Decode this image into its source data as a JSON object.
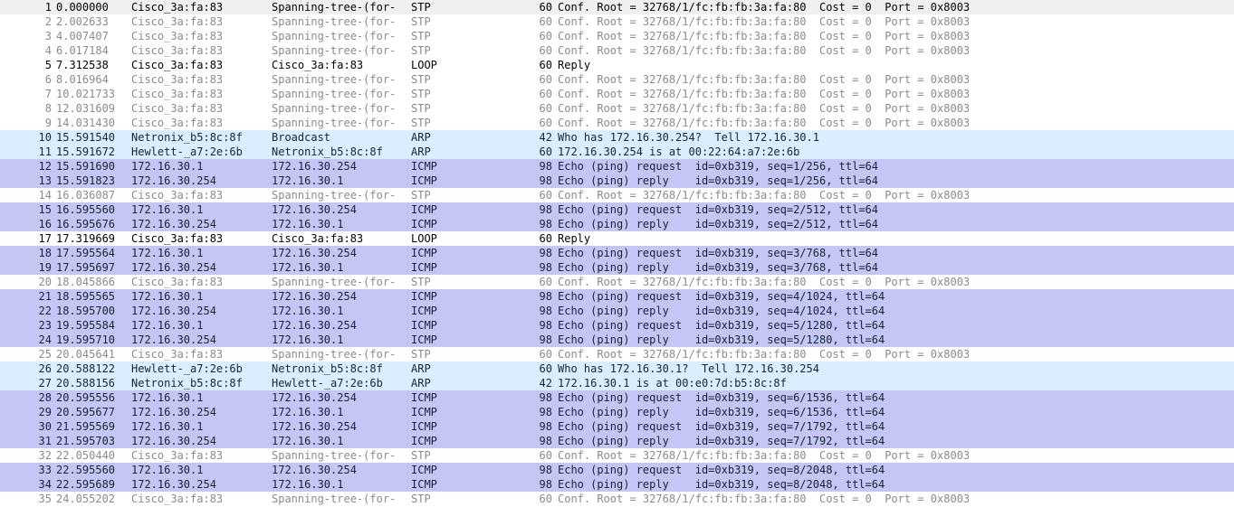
{
  "colors": {
    "stp_bg": "#ffffff",
    "stp_fg": "#8b8b8b",
    "loop_bg": "#ffffff",
    "loop_fg": "#000000",
    "arp_bg": "#daeeff",
    "icmp_bg": "#c6c6f6",
    "selected_bg": "#f0f0f0"
  },
  "packets": [
    {
      "no": "1",
      "time": "0.000000",
      "src": "Cisco_3a:fa:83",
      "dst": "Spanning-tree-(for-",
      "proto": "STP",
      "len": "60",
      "info": "Conf. Root = 32768/1/fc:fb:fb:3a:fa:80  Cost = 0  Port = 0x8003",
      "kind": "stp",
      "selected": true
    },
    {
      "no": "2",
      "time": "2.002633",
      "src": "Cisco_3a:fa:83",
      "dst": "Spanning-tree-(for-",
      "proto": "STP",
      "len": "60",
      "info": "Conf. Root = 32768/1/fc:fb:fb:3a:fa:80  Cost = 0  Port = 0x8003",
      "kind": "stp"
    },
    {
      "no": "3",
      "time": "4.007407",
      "src": "Cisco_3a:fa:83",
      "dst": "Spanning-tree-(for-",
      "proto": "STP",
      "len": "60",
      "info": "Conf. Root = 32768/1/fc:fb:fb:3a:fa:80  Cost = 0  Port = 0x8003",
      "kind": "stp"
    },
    {
      "no": "4",
      "time": "6.017184",
      "src": "Cisco_3a:fa:83",
      "dst": "Spanning-tree-(for-",
      "proto": "STP",
      "len": "60",
      "info": "Conf. Root = 32768/1/fc:fb:fb:3a:fa:80  Cost = 0  Port = 0x8003",
      "kind": "stp"
    },
    {
      "no": "5",
      "time": "7.312538",
      "src": "Cisco_3a:fa:83",
      "dst": "Cisco_3a:fa:83",
      "proto": "LOOP",
      "len": "60",
      "info": "Reply",
      "kind": "loop"
    },
    {
      "no": "6",
      "time": "8.016964",
      "src": "Cisco_3a:fa:83",
      "dst": "Spanning-tree-(for-",
      "proto": "STP",
      "len": "60",
      "info": "Conf. Root = 32768/1/fc:fb:fb:3a:fa:80  Cost = 0  Port = 0x8003",
      "kind": "stp"
    },
    {
      "no": "7",
      "time": "10.021733",
      "src": "Cisco_3a:fa:83",
      "dst": "Spanning-tree-(for-",
      "proto": "STP",
      "len": "60",
      "info": "Conf. Root = 32768/1/fc:fb:fb:3a:fa:80  Cost = 0  Port = 0x8003",
      "kind": "stp"
    },
    {
      "no": "8",
      "time": "12.031609",
      "src": "Cisco_3a:fa:83",
      "dst": "Spanning-tree-(for-",
      "proto": "STP",
      "len": "60",
      "info": "Conf. Root = 32768/1/fc:fb:fb:3a:fa:80  Cost = 0  Port = 0x8003",
      "kind": "stp"
    },
    {
      "no": "9",
      "time": "14.031430",
      "src": "Cisco_3a:fa:83",
      "dst": "Spanning-tree-(for-",
      "proto": "STP",
      "len": "60",
      "info": "Conf. Root = 32768/1/fc:fb:fb:3a:fa:80  Cost = 0  Port = 0x8003",
      "kind": "stp"
    },
    {
      "no": "10",
      "time": "15.591540",
      "src": "Netronix_b5:8c:8f",
      "dst": "Broadcast",
      "proto": "ARP",
      "len": "42",
      "info": "Who has 172.16.30.254?  Tell 172.16.30.1",
      "kind": "arp"
    },
    {
      "no": "11",
      "time": "15.591672",
      "src": "Hewlett-_a7:2e:6b",
      "dst": "Netronix_b5:8c:8f",
      "proto": "ARP",
      "len": "60",
      "info": "172.16.30.254 is at 00:22:64:a7:2e:6b",
      "kind": "arp"
    },
    {
      "no": "12",
      "time": "15.591690",
      "src": "172.16.30.1",
      "dst": "172.16.30.254",
      "proto": "ICMP",
      "len": "98",
      "info": "Echo (ping) request  id=0xb319, seq=1/256, ttl=64",
      "kind": "icmp"
    },
    {
      "no": "13",
      "time": "15.591823",
      "src": "172.16.30.254",
      "dst": "172.16.30.1",
      "proto": "ICMP",
      "len": "98",
      "info": "Echo (ping) reply    id=0xb319, seq=1/256, ttl=64",
      "kind": "icmp"
    },
    {
      "no": "14",
      "time": "16.036087",
      "src": "Cisco_3a:fa:83",
      "dst": "Spanning-tree-(for-",
      "proto": "STP",
      "len": "60",
      "info": "Conf. Root = 32768/1/fc:fb:fb:3a:fa:80  Cost = 0  Port = 0x8003",
      "kind": "stp"
    },
    {
      "no": "15",
      "time": "16.595560",
      "src": "172.16.30.1",
      "dst": "172.16.30.254",
      "proto": "ICMP",
      "len": "98",
      "info": "Echo (ping) request  id=0xb319, seq=2/512, ttl=64",
      "kind": "icmp"
    },
    {
      "no": "16",
      "time": "16.595676",
      "src": "172.16.30.254",
      "dst": "172.16.30.1",
      "proto": "ICMP",
      "len": "98",
      "info": "Echo (ping) reply    id=0xb319, seq=2/512, ttl=64",
      "kind": "icmp"
    },
    {
      "no": "17",
      "time": "17.319669",
      "src": "Cisco_3a:fa:83",
      "dst": "Cisco_3a:fa:83",
      "proto": "LOOP",
      "len": "60",
      "info": "Reply",
      "kind": "loop"
    },
    {
      "no": "18",
      "time": "17.595564",
      "src": "172.16.30.1",
      "dst": "172.16.30.254",
      "proto": "ICMP",
      "len": "98",
      "info": "Echo (ping) request  id=0xb319, seq=3/768, ttl=64",
      "kind": "icmp"
    },
    {
      "no": "19",
      "time": "17.595697",
      "src": "172.16.30.254",
      "dst": "172.16.30.1",
      "proto": "ICMP",
      "len": "98",
      "info": "Echo (ping) reply    id=0xb319, seq=3/768, ttl=64",
      "kind": "icmp"
    },
    {
      "no": "20",
      "time": "18.045866",
      "src": "Cisco_3a:fa:83",
      "dst": "Spanning-tree-(for-",
      "proto": "STP",
      "len": "60",
      "info": "Conf. Root = 32768/1/fc:fb:fb:3a:fa:80  Cost = 0  Port = 0x8003",
      "kind": "stp"
    },
    {
      "no": "21",
      "time": "18.595565",
      "src": "172.16.30.1",
      "dst": "172.16.30.254",
      "proto": "ICMP",
      "len": "98",
      "info": "Echo (ping) request  id=0xb319, seq=4/1024, ttl=64",
      "kind": "icmp"
    },
    {
      "no": "22",
      "time": "18.595700",
      "src": "172.16.30.254",
      "dst": "172.16.30.1",
      "proto": "ICMP",
      "len": "98",
      "info": "Echo (ping) reply    id=0xb319, seq=4/1024, ttl=64",
      "kind": "icmp"
    },
    {
      "no": "23",
      "time": "19.595584",
      "src": "172.16.30.1",
      "dst": "172.16.30.254",
      "proto": "ICMP",
      "len": "98",
      "info": "Echo (ping) request  id=0xb319, seq=5/1280, ttl=64",
      "kind": "icmp"
    },
    {
      "no": "24",
      "time": "19.595710",
      "src": "172.16.30.254",
      "dst": "172.16.30.1",
      "proto": "ICMP",
      "len": "98",
      "info": "Echo (ping) reply    id=0xb319, seq=5/1280, ttl=64",
      "kind": "icmp"
    },
    {
      "no": "25",
      "time": "20.045641",
      "src": "Cisco_3a:fa:83",
      "dst": "Spanning-tree-(for-",
      "proto": "STP",
      "len": "60",
      "info": "Conf. Root = 32768/1/fc:fb:fb:3a:fa:80  Cost = 0  Port = 0x8003",
      "kind": "stp"
    },
    {
      "no": "26",
      "time": "20.588122",
      "src": "Hewlett-_a7:2e:6b",
      "dst": "Netronix_b5:8c:8f",
      "proto": "ARP",
      "len": "60",
      "info": "Who has 172.16.30.1?  Tell 172.16.30.254",
      "kind": "arp"
    },
    {
      "no": "27",
      "time": "20.588156",
      "src": "Netronix_b5:8c:8f",
      "dst": "Hewlett-_a7:2e:6b",
      "proto": "ARP",
      "len": "42",
      "info": "172.16.30.1 is at 00:e0:7d:b5:8c:8f",
      "kind": "arp"
    },
    {
      "no": "28",
      "time": "20.595556",
      "src": "172.16.30.1",
      "dst": "172.16.30.254",
      "proto": "ICMP",
      "len": "98",
      "info": "Echo (ping) request  id=0xb319, seq=6/1536, ttl=64",
      "kind": "icmp"
    },
    {
      "no": "29",
      "time": "20.595677",
      "src": "172.16.30.254",
      "dst": "172.16.30.1",
      "proto": "ICMP",
      "len": "98",
      "info": "Echo (ping) reply    id=0xb319, seq=6/1536, ttl=64",
      "kind": "icmp"
    },
    {
      "no": "30",
      "time": "21.595569",
      "src": "172.16.30.1",
      "dst": "172.16.30.254",
      "proto": "ICMP",
      "len": "98",
      "info": "Echo (ping) request  id=0xb319, seq=7/1792, ttl=64",
      "kind": "icmp"
    },
    {
      "no": "31",
      "time": "21.595703",
      "src": "172.16.30.254",
      "dst": "172.16.30.1",
      "proto": "ICMP",
      "len": "98",
      "info": "Echo (ping) reply    id=0xb319, seq=7/1792, ttl=64",
      "kind": "icmp"
    },
    {
      "no": "32",
      "time": "22.050440",
      "src": "Cisco_3a:fa:83",
      "dst": "Spanning-tree-(for-",
      "proto": "STP",
      "len": "60",
      "info": "Conf. Root = 32768/1/fc:fb:fb:3a:fa:80  Cost = 0  Port = 0x8003",
      "kind": "stp"
    },
    {
      "no": "33",
      "time": "22.595560",
      "src": "172.16.30.1",
      "dst": "172.16.30.254",
      "proto": "ICMP",
      "len": "98",
      "info": "Echo (ping) request  id=0xb319, seq=8/2048, ttl=64",
      "kind": "icmp"
    },
    {
      "no": "34",
      "time": "22.595689",
      "src": "172.16.30.254",
      "dst": "172.16.30.1",
      "proto": "ICMP",
      "len": "98",
      "info": "Echo (ping) reply    id=0xb319, seq=8/2048, ttl=64",
      "kind": "icmp"
    },
    {
      "no": "35",
      "time": "24.055202",
      "src": "Cisco_3a:fa:83",
      "dst": "Spanning-tree-(for-",
      "proto": "STP",
      "len": "60",
      "info": "Conf. Root = 32768/1/fc:fb:fb:3a:fa:80  Cost = 0  Port = 0x8003",
      "kind": "stp"
    }
  ]
}
